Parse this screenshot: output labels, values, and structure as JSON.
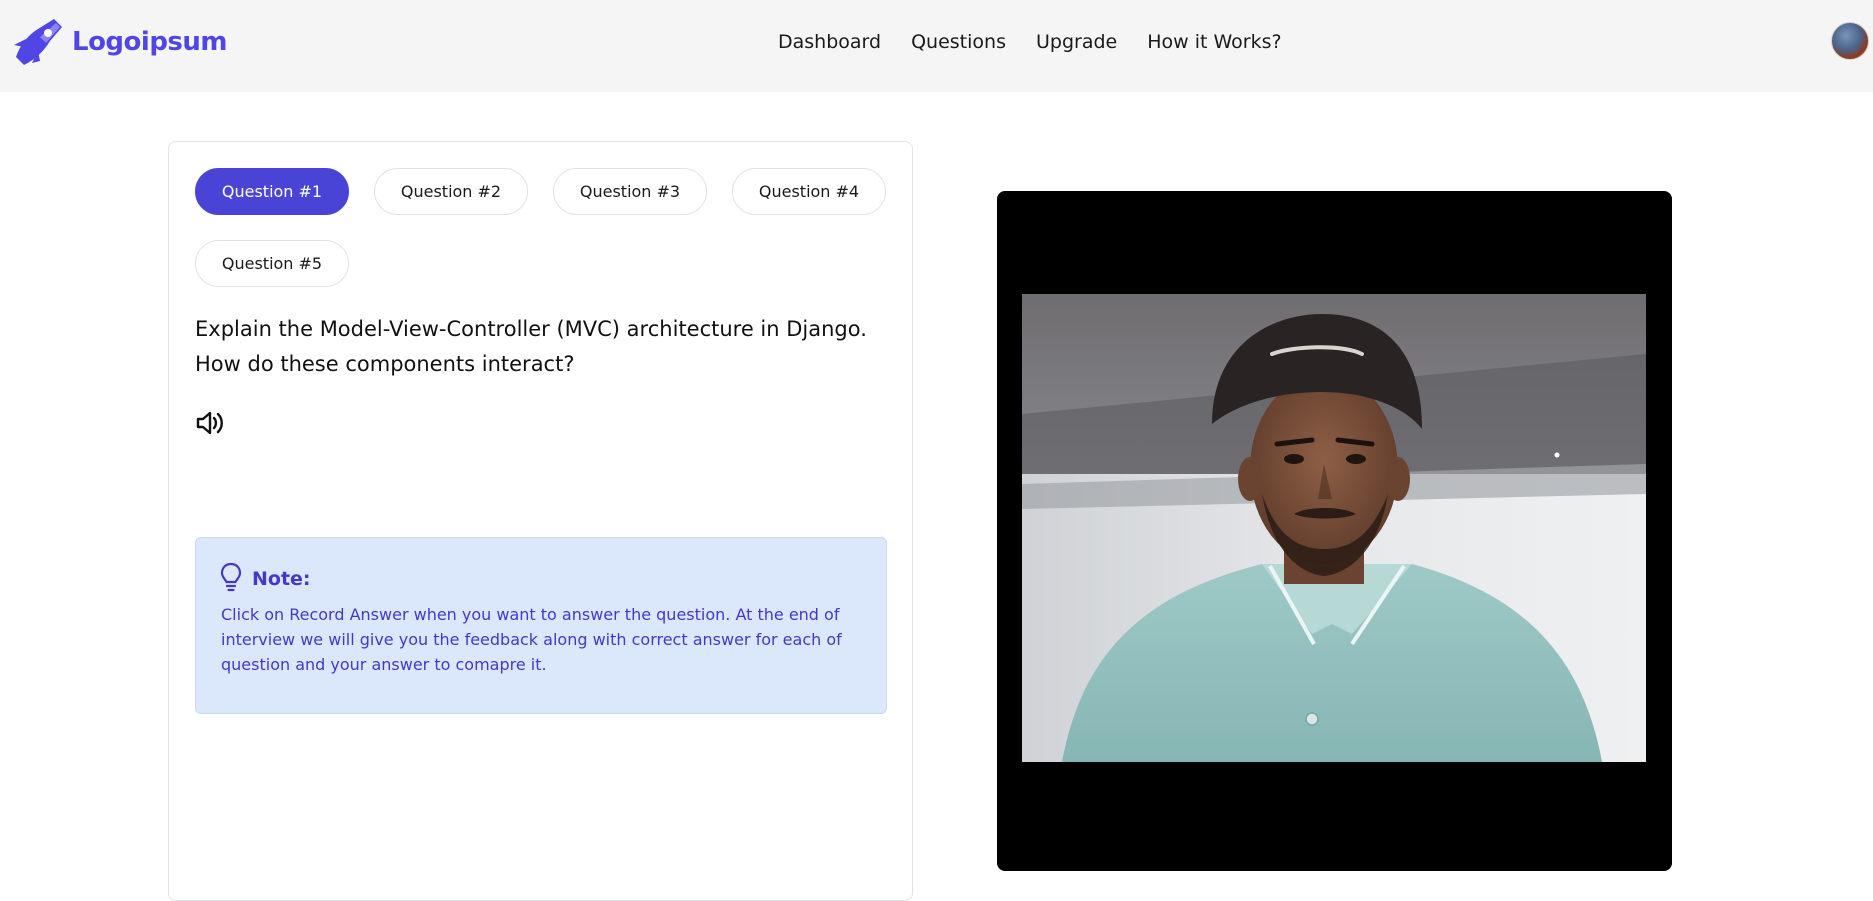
{
  "header": {
    "logo_text": "Logoipsum",
    "nav": [
      {
        "label": "Dashboard"
      },
      {
        "label": "Questions"
      },
      {
        "label": "Upgrade"
      },
      {
        "label": "How it Works?"
      }
    ]
  },
  "interview": {
    "tabs": [
      {
        "label": "Question #1",
        "active": true
      },
      {
        "label": "Question #2",
        "active": false
      },
      {
        "label": "Question #3",
        "active": false
      },
      {
        "label": "Question #4",
        "active": false
      },
      {
        "label": "Question #5",
        "active": false
      }
    ],
    "question_line1": "Explain the Model-View-Controller (MVC) architecture in Django.",
    "question_line2": "How do these components interact?",
    "note": {
      "title": "Note:",
      "body_line1": "Click on Record Answer when you want to answer the question. At the end of",
      "body_line2": "interview we will give you the feedback along with correct answer for each of",
      "body_line3": "question and your answer to comapre it."
    }
  },
  "colors": {
    "accent": "#4a44d6",
    "note_bg": "#dbe8fc",
    "note_text": "#4338ca",
    "header_bg": "#f5f5f5"
  },
  "icons": {
    "logo": "rocket-logo-icon",
    "speaker": "speaker-volume-icon",
    "note": "lightbulb-icon"
  }
}
